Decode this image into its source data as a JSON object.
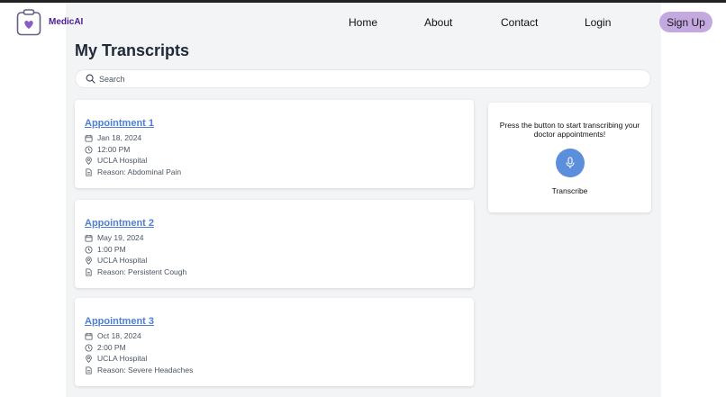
{
  "header": {
    "brand": "MedicAI",
    "nav": {
      "home": "Home",
      "about": "About",
      "contact": "Contact",
      "login": "Login"
    },
    "signup": "Sign Up",
    "colors": {
      "brand": "#4c1d95",
      "signup_bg": "#c4a8e0"
    }
  },
  "main": {
    "title": "My Transcripts",
    "search": {
      "placeholder": "Search",
      "value": ""
    },
    "appointments": [
      {
        "title": "Appointment 1",
        "date": "Jan 18, 2024",
        "time": "12:00 PM",
        "location": "UCLA Hospital",
        "reason": "Reason: Abdominal Pain"
      },
      {
        "title": "Appointment 2",
        "date": "May 19, 2024",
        "time": "1:00 PM",
        "location": "UCLA Hospital",
        "reason": "Reason: Persistent Cough"
      },
      {
        "title": "Appointment 3",
        "date": "Oct 18, 2024",
        "time": "2:00 PM",
        "location": "UCLA Hospital",
        "reason": "Reason: Severe Headaches"
      }
    ],
    "row_icons": [
      "calendar-icon",
      "clock-icon",
      "map-pin-icon",
      "document-icon"
    ]
  },
  "sidebar": {
    "prompt": "Press the button to start transcribing your doctor appointments!",
    "button_icon": "microphone-icon",
    "label": "Transcribe",
    "colors": {
      "mic_bg": "#5b8fdc",
      "link": "#4f7fd1"
    }
  }
}
